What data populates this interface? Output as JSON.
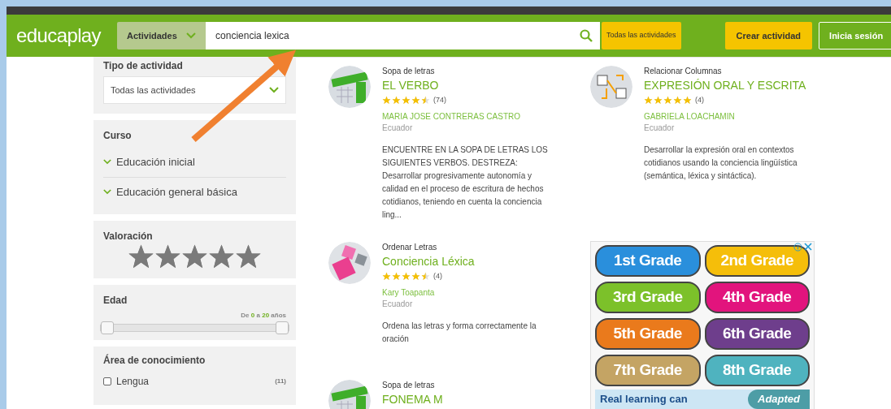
{
  "header": {
    "logo": "educaplay",
    "category_select": "Actividades",
    "search": {
      "value": "conciencia lexica"
    },
    "filter_button": "Todas las actividades",
    "create_button": "Crear actividad",
    "login_button": "Inicia sesión"
  },
  "sidebar": {
    "activity_type": {
      "title": "Tipo de actividad",
      "select": "Todas las actividades"
    },
    "course": {
      "title": "Curso",
      "items": [
        {
          "label": "Educación inicial",
          "expanded": false
        },
        {
          "label": "Educación general básica",
          "expanded": false
        }
      ]
    },
    "rating": {
      "title": "Valoración"
    },
    "age": {
      "title": "Edad",
      "range_prefix": "De",
      "min": "0",
      "range_joiner": "a",
      "max": "20",
      "unit": "años",
      "handles": [
        {
          "level": 0
        },
        {
          "level": 1
        }
      ]
    },
    "area": {
      "title": "Área de conocimiento",
      "items": [
        {
          "label": "Lengua",
          "count": "(11)",
          "checked": false
        }
      ]
    }
  },
  "results": [
    {
      "kind": "letters",
      "type": "Sopa de letras",
      "title": "EL VERBO",
      "stars": 4.5,
      "reviews": "(74)",
      "author": "MARIA JOSE CONTRERAS CASTRO",
      "country": "Ecuador",
      "description": "ENCUENTRE EN LA SOPA DE LETRAS LOS SIGUIENTES VERBOS. DESTREZA: Desarrollar progresivamente autonomía y calidad en el proceso de escritura de hechos cotidianos, teniendo en cuenta la conciencia ling..."
    },
    {
      "kind": "columns",
      "type": "Relacionar Columnas",
      "title": "EXPRESIÓN ORAL Y ESCRITA",
      "stars": 5,
      "reviews": "(4)",
      "author": "GABRIELA LOACHAMIN",
      "country": "Ecuador",
      "description": "Desarrollar la expresión oral en contextos cotidianos usando la conciencia lingüística (semántica, léxica y sintáctica)."
    },
    {
      "kind": "keys",
      "type": "Ordenar Letras",
      "title": "Conciencia Léxica",
      "stars": 4.5,
      "reviews": "(4)",
      "author": "Kary Toapanta",
      "country": "Ecuador",
      "description": "Ordena las letras y forma correctamente la oración"
    },
    {
      "kind": "letters",
      "type": "Sopa de letras",
      "title": "FONEMA M"
    }
  ],
  "ad": {
    "buttons": [
      {
        "label": "1st Grade",
        "color": "#2a8fdc"
      },
      {
        "label": "2nd Grade",
        "color": "#f5be0a"
      },
      {
        "label": "3rd Grade",
        "color": "#7cc12a"
      },
      {
        "label": "4th Grade",
        "color": "#e2147d"
      },
      {
        "label": "5th Grade",
        "color": "#ea7a1c"
      },
      {
        "label": "6th Grade",
        "color": "#6e3e8c"
      },
      {
        "label": "7th Grade",
        "color": "#c4a464"
      },
      {
        "label": "8th Grade",
        "color": "#4fb3bf"
      }
    ],
    "banner": "Real learning can",
    "banner_badge": "Adapted"
  }
}
